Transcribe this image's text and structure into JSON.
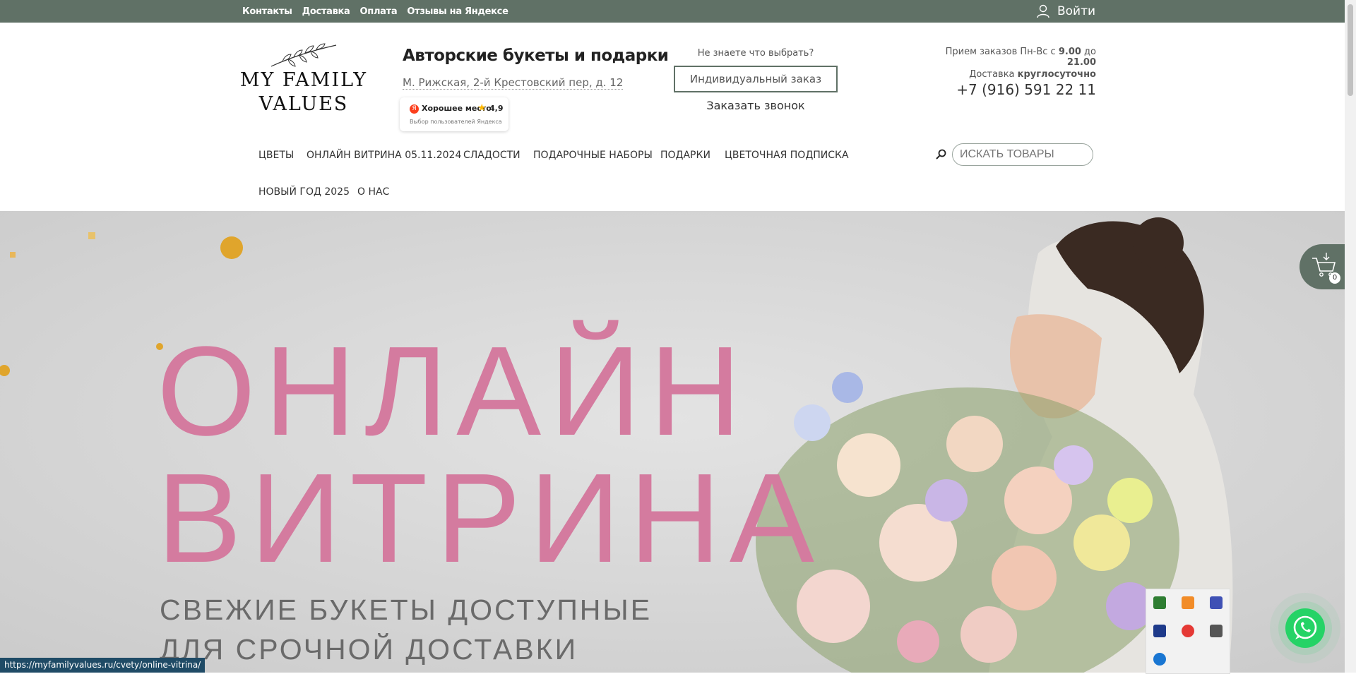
{
  "topbar": {
    "links": [
      "Контакты",
      "Доставка",
      "Оплата",
      "Отзывы на Яндексе"
    ],
    "login_label": "Войти"
  },
  "logo": {
    "line1": "MY FAMILY",
    "line2": "VALUES"
  },
  "header": {
    "title": "Авторские букеты и подарки",
    "address": "М. Рижская, 2-й Крестовский пер, д. 12",
    "yandex": {
      "place": "Хорошее место",
      "rating": "4,9",
      "sub": "Выбор пользователей Яндекса"
    },
    "choose": {
      "question": "Не знаете что выбрать?",
      "individual": "Индивидуальный заказ",
      "callback": "Заказать звонок"
    },
    "hours": {
      "prefix": "Прием заказов Пн-Вс с ",
      "from": "9.00",
      "mid": " до ",
      "to": "21.00",
      "delivery": "Доставка ",
      "delivery_bold": "круглосуточно",
      "phone": "+7 (916) 591 22 11"
    }
  },
  "nav": {
    "items": [
      "Цветы",
      "Онлайн витрина 05.11.2024",
      "Сладости",
      "Подарочные наборы",
      "Подарки",
      "Цветочная подписка",
      "Новый год 2025",
      "О нас"
    ]
  },
  "search": {
    "placeholder": "ИСКАТЬ ТОВАРЫ"
  },
  "hero": {
    "line1": "ОНЛАЙН",
    "line2": "ВИТРИНА",
    "sub1": "СВЕЖИЕ БУКЕТЫ ДОСТУПНЫЕ",
    "sub2": "ДЛЯ СРОЧНОЙ ДОСТАВКИ"
  },
  "cart": {
    "count": "0"
  },
  "status_url": "https://myfamilyvalues.ru/cvety/online-vitrina/",
  "colors": {
    "topbar": "#607166",
    "hero_title": "#d47b9f",
    "whatsapp": "#25d366"
  }
}
